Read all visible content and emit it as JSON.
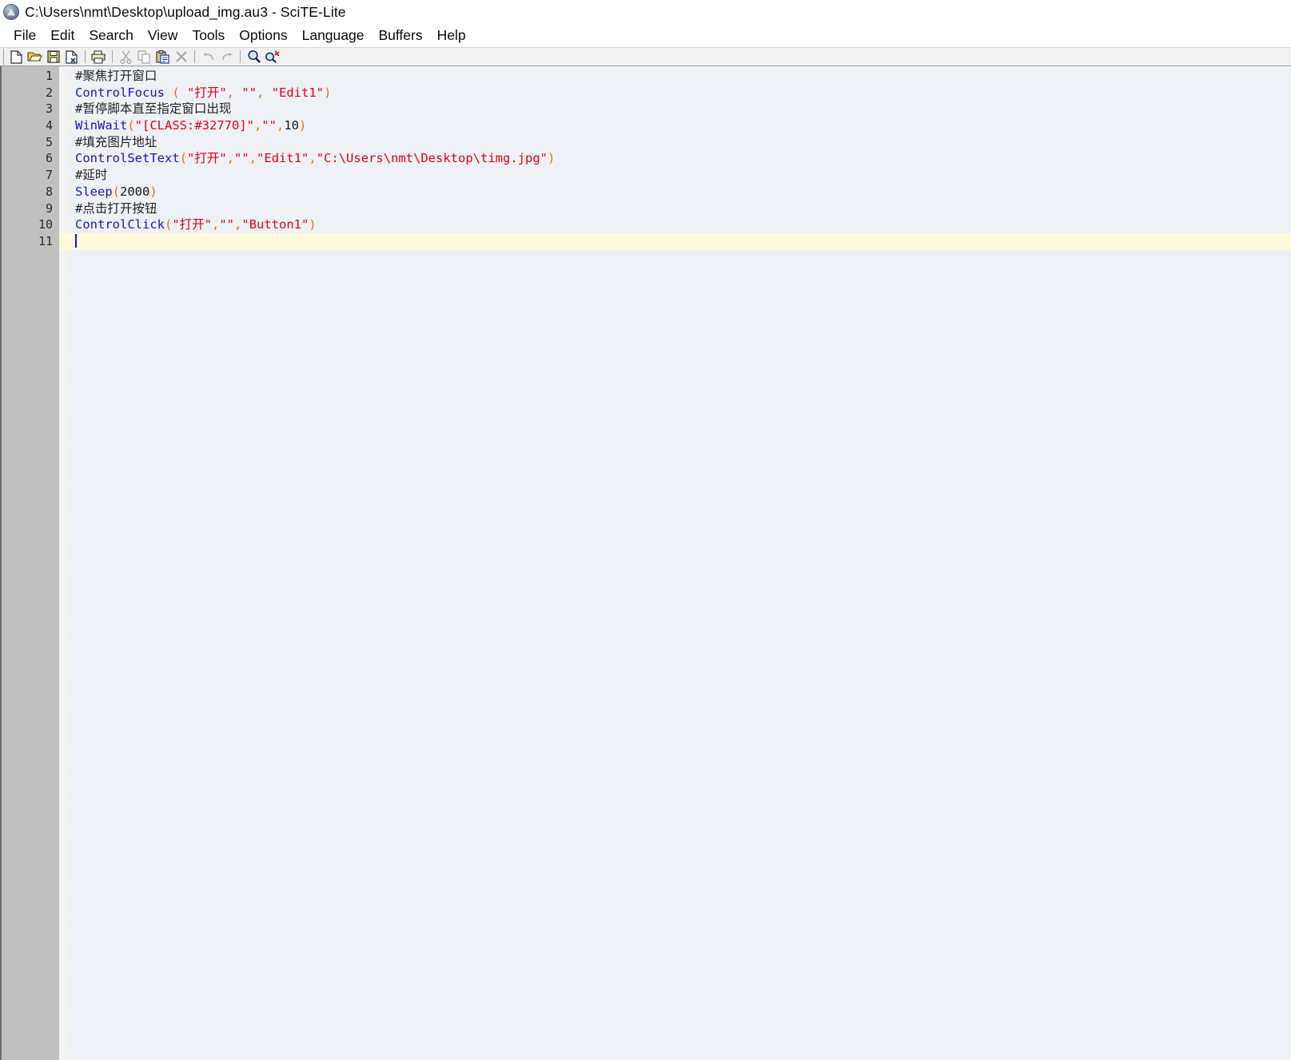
{
  "window": {
    "title": "C:\\Users\\nmt\\Desktop\\upload_img.au3 - SciTE-Lite",
    "app_icon": "autoit-logo-icon"
  },
  "menubar": {
    "items": [
      {
        "label": "File"
      },
      {
        "label": "Edit"
      },
      {
        "label": "Search"
      },
      {
        "label": "View"
      },
      {
        "label": "Tools"
      },
      {
        "label": "Options"
      },
      {
        "label": "Language"
      },
      {
        "label": "Buffers"
      },
      {
        "label": "Help"
      }
    ]
  },
  "toolbar": {
    "buttons": [
      {
        "name": "new-file-icon",
        "enabled": true
      },
      {
        "name": "open-file-icon",
        "enabled": true
      },
      {
        "name": "save-file-icon",
        "enabled": true
      },
      {
        "name": "close-file-icon",
        "enabled": true
      },
      {
        "name": "print-icon",
        "enabled": true
      },
      {
        "name": "cut-icon",
        "enabled": false
      },
      {
        "name": "copy-icon",
        "enabled": false
      },
      {
        "name": "paste-icon",
        "enabled": true
      },
      {
        "name": "delete-icon",
        "enabled": false
      },
      {
        "name": "undo-icon",
        "enabled": false
      },
      {
        "name": "redo-icon",
        "enabled": false
      },
      {
        "name": "find-icon",
        "enabled": true
      },
      {
        "name": "replace-icon",
        "enabled": true
      }
    ]
  },
  "editor": {
    "language": "AutoIt",
    "current_line": 11,
    "caret_column": 1,
    "line_numbers": [
      "1",
      "2",
      "3",
      "4",
      "5",
      "6",
      "7",
      "8",
      "9",
      "10",
      "11"
    ],
    "lines": [
      {
        "num": "1",
        "tokens": [
          {
            "t": "comment",
            "v": "#聚焦打开窗口"
          }
        ]
      },
      {
        "num": "2",
        "tokens": [
          {
            "t": "func",
            "v": "ControlFocus"
          },
          {
            "t": "punct",
            "v": " ( "
          },
          {
            "t": "str",
            "v": "\"打开\""
          },
          {
            "t": "punct",
            "v": ", "
          },
          {
            "t": "str",
            "v": "\"\""
          },
          {
            "t": "punct",
            "v": ", "
          },
          {
            "t": "str",
            "v": "\"Edit1\""
          },
          {
            "t": "punct",
            "v": ")"
          }
        ]
      },
      {
        "num": "3",
        "tokens": [
          {
            "t": "comment",
            "v": "#暂停脚本直至指定窗口出现"
          }
        ]
      },
      {
        "num": "4",
        "tokens": [
          {
            "t": "func",
            "v": "WinWait"
          },
          {
            "t": "punct",
            "v": "("
          },
          {
            "t": "str",
            "v": "\"[CLASS:#32770]\""
          },
          {
            "t": "punct",
            "v": ","
          },
          {
            "t": "str",
            "v": "\"\""
          },
          {
            "t": "punct",
            "v": ","
          },
          {
            "t": "num",
            "v": "10"
          },
          {
            "t": "punct",
            "v": ")"
          }
        ]
      },
      {
        "num": "5",
        "tokens": [
          {
            "t": "comment",
            "v": "#填充图片地址"
          }
        ]
      },
      {
        "num": "6",
        "tokens": [
          {
            "t": "func",
            "v": "ControlSetText"
          },
          {
            "t": "punct",
            "v": "("
          },
          {
            "t": "str",
            "v": "\"打开\""
          },
          {
            "t": "punct",
            "v": ","
          },
          {
            "t": "str",
            "v": "\"\""
          },
          {
            "t": "punct",
            "v": ","
          },
          {
            "t": "str",
            "v": "\"Edit1\""
          },
          {
            "t": "punct",
            "v": ","
          },
          {
            "t": "str",
            "v": "\"C:\\Users\\nmt\\Desktop\\timg.jpg\""
          },
          {
            "t": "punct",
            "v": ")"
          }
        ]
      },
      {
        "num": "7",
        "tokens": [
          {
            "t": "comment",
            "v": "#延时"
          }
        ]
      },
      {
        "num": "8",
        "tokens": [
          {
            "t": "func",
            "v": "Sleep"
          },
          {
            "t": "punct",
            "v": "("
          },
          {
            "t": "num",
            "v": "2000"
          },
          {
            "t": "punct",
            "v": ")"
          }
        ]
      },
      {
        "num": "9",
        "tokens": [
          {
            "t": "comment",
            "v": "#点击打开按钮"
          }
        ]
      },
      {
        "num": "10",
        "tokens": [
          {
            "t": "func",
            "v": "ControlClick"
          },
          {
            "t": "punct",
            "v": "("
          },
          {
            "t": "str",
            "v": "\"打开\""
          },
          {
            "t": "punct",
            "v": ","
          },
          {
            "t": "str",
            "v": "\"\""
          },
          {
            "t": "punct",
            "v": ","
          },
          {
            "t": "str",
            "v": "\"Button1\""
          },
          {
            "t": "punct",
            "v": ")"
          }
        ]
      },
      {
        "num": "11",
        "tokens": []
      }
    ]
  },
  "colors": {
    "function": "#1616c8",
    "string": "#e6000f",
    "punctuation": "#e8730c",
    "comment": "#242424",
    "number": "#1a1a1a",
    "editor_background": "#eef1f6",
    "gutter_background": "#c0c0c0",
    "current_line_background": "#fdfbdb",
    "caret": "#1616c8"
  }
}
